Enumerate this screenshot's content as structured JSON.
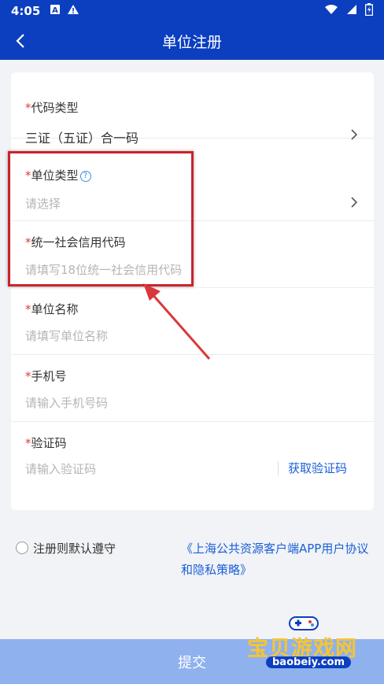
{
  "status_bar": {
    "time": "4:05",
    "icons": [
      "sim-icon",
      "warning-icon",
      "wifi-icon",
      "signal-icon",
      "battery-icon"
    ]
  },
  "header": {
    "title": "单位注册",
    "back_icon": "chevron-left-icon"
  },
  "form": {
    "required_mark": "*",
    "code_type": {
      "label": "代码类型",
      "value": "三证（五证）合一码"
    },
    "unit_type": {
      "label": "单位类型",
      "help": "?",
      "placeholder": "请选择"
    },
    "credit_code": {
      "label": "统一社会信用代码",
      "placeholder": "请填写18位统一社会信用代码"
    },
    "unit_name": {
      "label": "单位名称",
      "placeholder": "请填写单位名称"
    },
    "phone": {
      "label": "手机号",
      "placeholder": "请输入手机号码"
    },
    "verify_code": {
      "label": "验证码",
      "placeholder": "请输入验证码",
      "get_code": "获取验证码"
    }
  },
  "agreement": {
    "text": "注册则默认遵守",
    "link_line1": "《上海公共资源客户端APP用户协议",
    "link_line2": "和隐私策略》"
  },
  "submit_label": "提交",
  "watermark": {
    "text": "宝贝游戏网",
    "url": "baobeiy.com"
  },
  "colors": {
    "header": "#0b3fc0",
    "required": "#e23b3b",
    "link": "#1a5fd6",
    "highlight": "#c9232b",
    "submit": "#8fb1ee"
  }
}
